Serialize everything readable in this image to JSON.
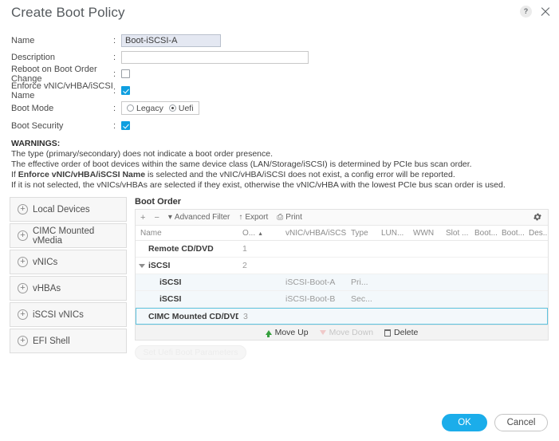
{
  "header": {
    "title": "Create Boot Policy",
    "help_icon": "help-circle-icon",
    "close_icon": "close-icon"
  },
  "form": {
    "colon": ":",
    "fields": [
      {
        "label": "Name",
        "type": "text",
        "value": "Boot-iSCSI-A",
        "placeholder": ""
      },
      {
        "label": "Description",
        "type": "text",
        "value": "",
        "placeholder": ""
      },
      {
        "label": "Reboot on Boot Order Change",
        "type": "checkbox",
        "checked": false
      },
      {
        "label": "Enforce vNIC/vHBA/iSCSI Name",
        "type": "checkbox",
        "checked": true
      },
      {
        "label": "Boot Mode",
        "type": "radio",
        "options": [
          "Legacy",
          "Uefi"
        ],
        "selected": "Uefi"
      },
      {
        "label": "Boot Security",
        "type": "checkbox",
        "checked": true
      }
    ]
  },
  "warnings": {
    "title": "WARNINGS:",
    "lines": [
      "The type (primary/secondary) does not indicate a boot order presence.",
      "The effective order of boot devices within the same device class (LAN/Storage/iSCSI) is determined by PCIe bus scan order."
    ],
    "line3_pre": "If ",
    "line3_bold": "Enforce vNIC/vHBA/iSCSI Name",
    "line3_post": " is selected and the vNIC/vHBA/iSCSI does not exist, a config error will be reported.",
    "line4": "If it is not selected, the vNICs/vHBAs are selected if they exist, otherwise the vNIC/vHBA with the lowest PCIe bus scan order is used."
  },
  "sidebar": {
    "items": [
      {
        "label": "Local Devices",
        "icon": "plus-circle-icon"
      },
      {
        "label": "CIMC Mounted vMedia",
        "icon": "plus-circle-icon"
      },
      {
        "label": "vNICs",
        "icon": "plus-circle-icon"
      },
      {
        "label": "vHBAs",
        "icon": "plus-circle-icon"
      },
      {
        "label": "iSCSI vNICs",
        "icon": "plus-circle-icon"
      },
      {
        "label": "EFI Shell",
        "icon": "plus-circle-icon"
      }
    ]
  },
  "boot_order": {
    "title": "Boot Order",
    "toolbar": {
      "add": "+",
      "remove": "−",
      "advanced_filter": "Advanced Filter",
      "export": "Export",
      "print": "Print",
      "gear_icon": "gear-icon"
    },
    "columns": [
      "Name",
      "O...",
      "vNIC/vHBA/iSCSI...",
      "Type",
      "LUN...",
      "WWN",
      "Slot ...",
      "Boot...",
      "Boot...",
      "Des..."
    ],
    "sorted_column": "O...",
    "sort_direction": "▲",
    "rows": [
      {
        "name": "Remote CD/DVD",
        "order": "1",
        "vnic": "",
        "type": "",
        "indent": 0,
        "expander": "",
        "selected": false,
        "alt": false
      },
      {
        "name": "iSCSI",
        "order": "2",
        "vnic": "",
        "type": "",
        "indent": 0,
        "expander": "expanded",
        "selected": false,
        "alt": false
      },
      {
        "name": "iSCSI",
        "order": "",
        "vnic": "iSCSI-Boot-A",
        "type": "Pri...",
        "indent": 1,
        "expander": "",
        "selected": false,
        "alt": true
      },
      {
        "name": "iSCSI",
        "order": "",
        "vnic": "iSCSI-Boot-B",
        "type": "Sec...",
        "indent": 1,
        "expander": "",
        "selected": false,
        "alt": true
      },
      {
        "name": "CIMC Mounted CD/DVD",
        "order": "3",
        "vnic": "",
        "type": "",
        "indent": 0,
        "expander": "",
        "selected": true,
        "alt": false
      }
    ],
    "footer": {
      "move_up": "Move Up",
      "move_down": "Move Down",
      "delete": "Delete",
      "move_down_disabled": true
    },
    "uefi_params_button": "Set Uefi Boot Parameters"
  },
  "footer": {
    "ok": "OK",
    "cancel": "Cancel"
  },
  "colors": {
    "accent": "#1badea",
    "checkbox_on": "#0e9fe0",
    "selected_row_border": "#5fc4e0",
    "move_up_arrow": "#37a03f"
  }
}
